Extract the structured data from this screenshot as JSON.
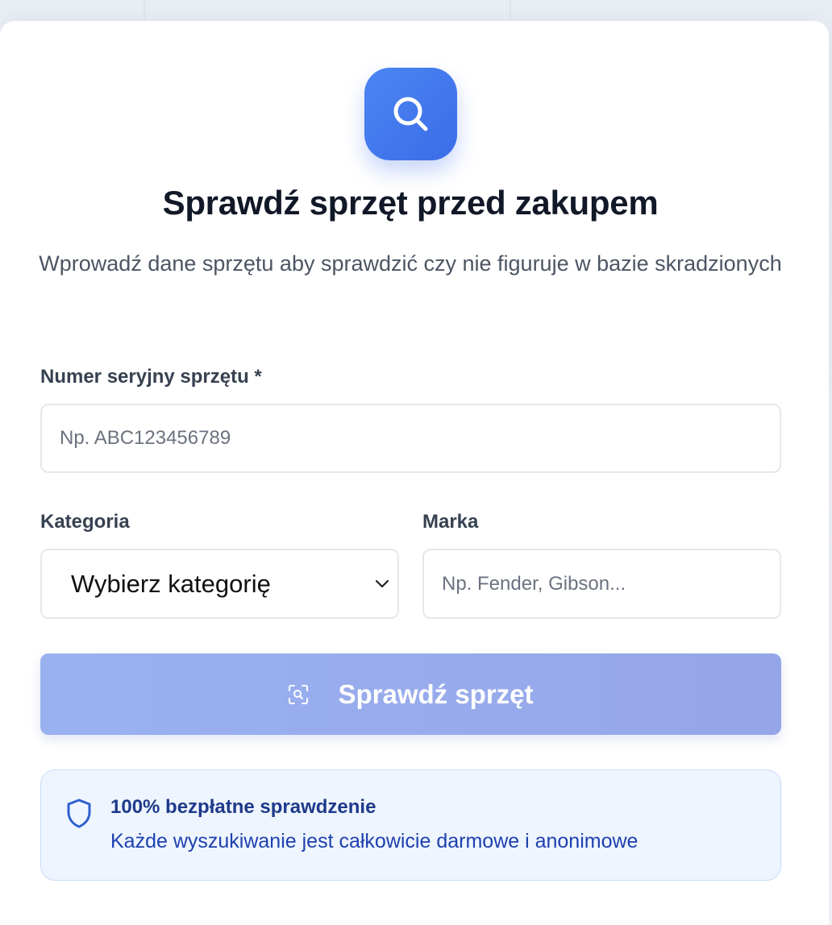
{
  "header": {
    "title": "Sprawdź sprzęt przed zakupem",
    "subtitle": "Wprowadź dane sprzętu aby sprawdzić czy nie figuruje w bazie skradzionych",
    "icon": "search-icon"
  },
  "form": {
    "serial": {
      "label": "Numer seryjny sprzętu *",
      "placeholder": "Np. ABC123456789",
      "value": ""
    },
    "category": {
      "label": "Kategoria",
      "selected": "Wybierz kategorię",
      "icon": "chevron-down-icon"
    },
    "brand": {
      "label": "Marka",
      "placeholder": "Np. Fender, Gibson...",
      "value": ""
    },
    "submit": {
      "label": "Sprawdź sprzęt",
      "icon": "scan-search-icon",
      "state": "disabled"
    }
  },
  "info": {
    "icon": "shield-icon",
    "title": "100% bezpłatne sprawdzenie",
    "text": "Każde wyszukiwanie jest całkowicie darmowe i anonimowe"
  },
  "colors": {
    "accent": "#3b6ce8",
    "button_disabled": "#9ab1f0",
    "info_bg": "#eef5fe",
    "info_text": "#1e40af",
    "title": "#111827"
  }
}
